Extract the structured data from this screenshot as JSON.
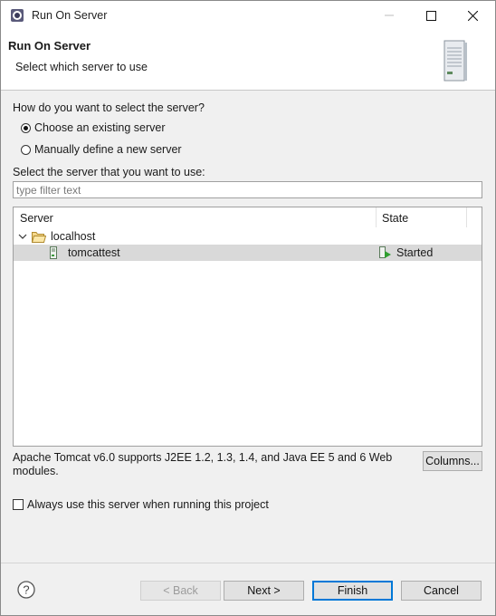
{
  "window": {
    "title": "Run On Server"
  },
  "banner": {
    "title": "Run On Server",
    "subtitle": "Select which server to use",
    "icon": "server-icon"
  },
  "selection": {
    "question": "How do you want to select the server?",
    "options": [
      {
        "label": "Choose an existing server",
        "selected": true
      },
      {
        "label": "Manually define a new server",
        "selected": false
      }
    ]
  },
  "filter": {
    "label": "Select the server that you want to use:",
    "placeholder": "type filter text",
    "value": ""
  },
  "table": {
    "columns": [
      "Server",
      "State"
    ],
    "rows": [
      {
        "name": "localhost",
        "type": "folder",
        "expanded": true,
        "state": ""
      },
      {
        "name": "tomcattest",
        "type": "server",
        "state": "Started",
        "selected": true
      }
    ]
  },
  "description": "Apache Tomcat v6.0 supports J2EE 1.2, 1.3, 1.4, and Java EE 5 and 6 Web modules.",
  "buttons": {
    "columns": "Columns...",
    "back": "< Back",
    "next": "Next >",
    "finish": "Finish",
    "cancel": "Cancel"
  },
  "always_use": {
    "label": "Always use this server when running this project",
    "checked": false
  },
  "colors": {
    "accent": "#0078d7",
    "selected_row": "#d9d9d9"
  }
}
